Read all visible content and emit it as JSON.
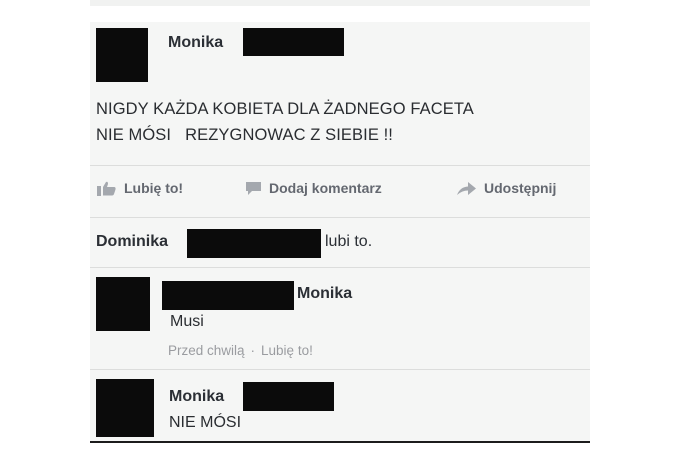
{
  "post": {
    "author": "Monika",
    "text_line1": "NIGDY KAŻDA KOBIETA DLA ŻADNEGO FACETA",
    "text_line2": "NIE MÓSI   REZYGNOWAC Z SIEBIE !!"
  },
  "actions": {
    "like_label": "Lubię to!",
    "comment_label": "Dodaj komentarz",
    "share_label": "Udostępnij",
    "like_icon": "thumbs-up-icon",
    "comment_icon": "speech-bubble-icon",
    "share_icon": "share-arrow-icon"
  },
  "likes": {
    "name": "Dominika",
    "suffix": "lubi to."
  },
  "comments": [
    {
      "author": "Monika",
      "text": "Musi",
      "time": "Przed chwilą",
      "separator": "·",
      "like_label": "Lubię to!"
    },
    {
      "author": "Monika",
      "text": "NIE MÓSI"
    }
  ],
  "colors": {
    "card_background": "#f5f6f5",
    "redaction": "#0b0b0b",
    "name_text": "#2b2f35",
    "action_text": "#646870",
    "meta_text": "#9a9ca0"
  }
}
